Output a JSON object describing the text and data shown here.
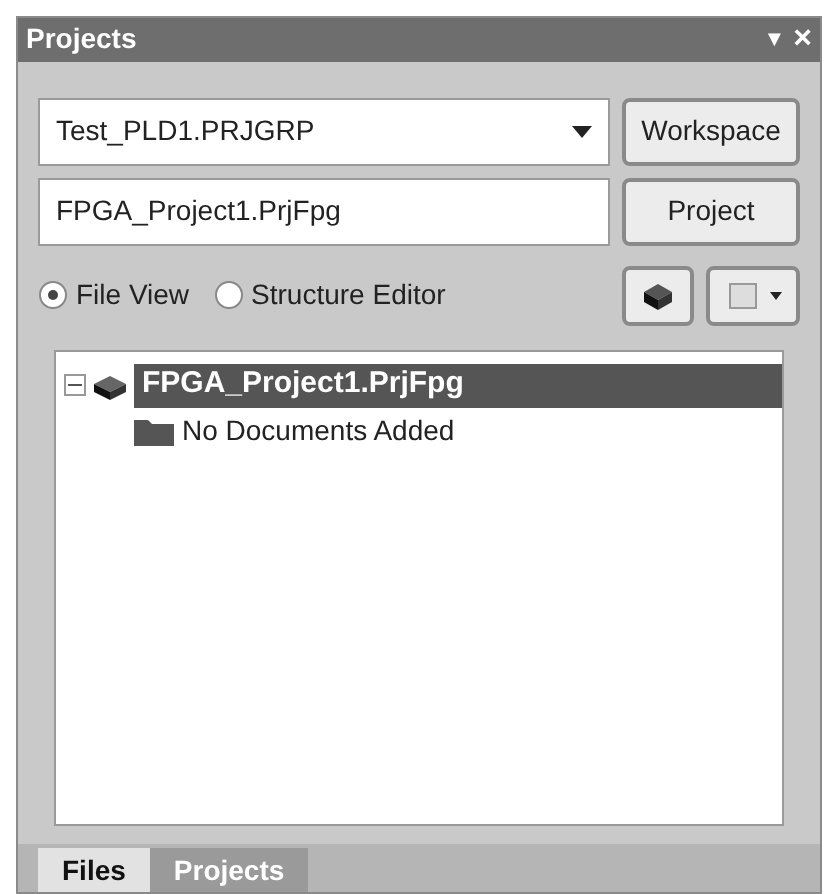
{
  "panel": {
    "title": "Projects",
    "menu_glyph": "▼",
    "close_glyph": "×"
  },
  "workspace": {
    "value": "Test_PLD1.PRJGRP",
    "button": "Workspace"
  },
  "project": {
    "value": "FPGA_Project1.PrjFpg",
    "button": "Project"
  },
  "views": [
    {
      "label": "File View",
      "selected": true
    },
    {
      "label": "Structure Editor",
      "selected": false
    }
  ],
  "tree": [
    {
      "label": "FPGA_Project1.PrjFpg",
      "expanded": true,
      "selected": true,
      "children": [
        {
          "label": "No Documents Added",
          "selected": false
        }
      ]
    }
  ],
  "tabs": [
    {
      "label": "Files",
      "selected": false
    },
    {
      "label": "Projects",
      "selected": true
    }
  ]
}
